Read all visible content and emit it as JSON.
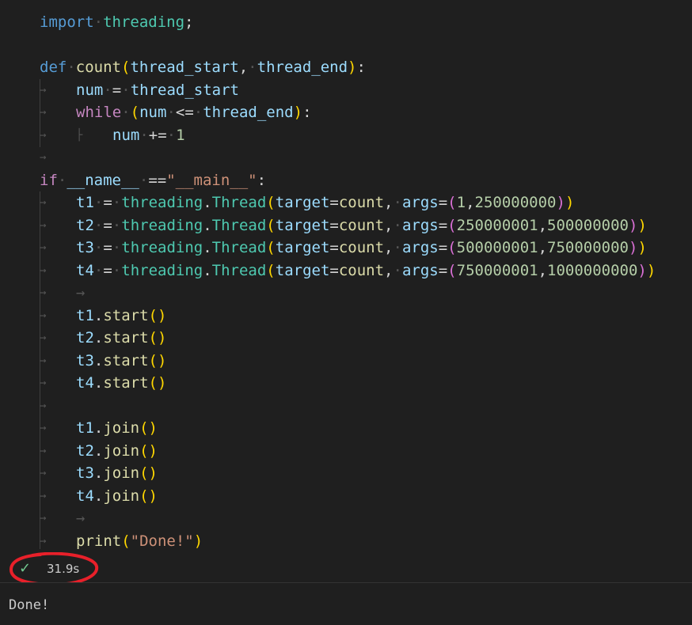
{
  "code": {
    "line1": {
      "kw": "import",
      "mod": "threading",
      "end": ";"
    },
    "line3": {
      "kw": "def",
      "fn": "count",
      "p_open": "(",
      "a1": "thread_start",
      "comma": ", ",
      "a2": "thread_end",
      "p_close": ")",
      "colon": ":"
    },
    "line4": {
      "var": "num",
      "op": " = ",
      "val": "thread_start"
    },
    "line5": {
      "kw": "while",
      "p_open": "(",
      "var": "num",
      "op": " <= ",
      "val": "thread_end",
      "p_close": ")",
      "colon": ":"
    },
    "line6": {
      "var": "num",
      "op": " += ",
      "num": "1"
    },
    "line8": {
      "kw": "if",
      "name": "__name__",
      "op": " ==",
      "str": "\"__main__\"",
      "colon": ":"
    },
    "threads": [
      {
        "var": "t1",
        "args_a": "1",
        "args_b": "250000000"
      },
      {
        "var": "t2",
        "args_a": "250000001",
        "args_b": "500000000"
      },
      {
        "var": "t3",
        "args_a": "500000001",
        "args_b": "750000000"
      },
      {
        "var": "t4",
        "args_a": "750000001",
        "args_b": "1000000000"
      }
    ],
    "thread_ctor": {
      "mod": "threading",
      "dot": ".",
      "cls": "Thread",
      "target_kw": "target",
      "eq": "=",
      "target_val": "count",
      "args_kw": "args"
    },
    "starts": [
      "t1",
      "t2",
      "t3",
      "t4"
    ],
    "start_method": "start",
    "join_method": "join",
    "print_fn": "print",
    "print_str": "\"Done!\""
  },
  "status": {
    "icon": "check-icon",
    "time": "31.9s"
  },
  "output": {
    "text": "Done!"
  },
  "colors": {
    "background": "#1f1f1f",
    "keyword": "#569cd6",
    "control": "#c586c0",
    "function": "#dcdcaa",
    "variable": "#9cdcfe",
    "class": "#4ec9b0",
    "number": "#b5cea8",
    "string": "#ce9178",
    "check": "#73c991",
    "annotation": "#e8202a"
  }
}
